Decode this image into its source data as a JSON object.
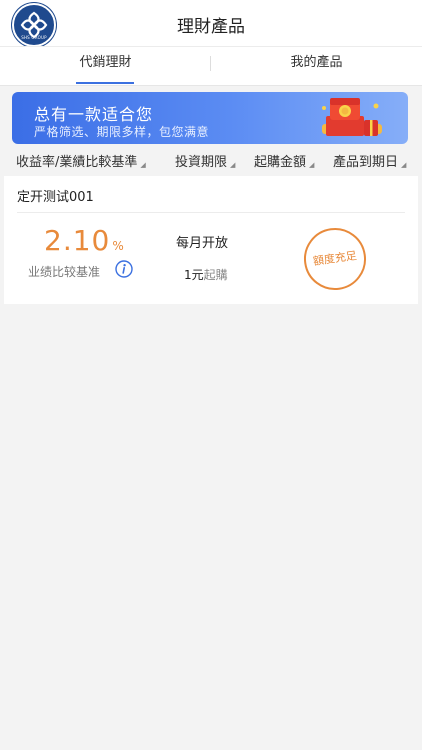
{
  "header": {
    "title": "理財產品",
    "logo_caption": "SHS GROUP"
  },
  "tabs": [
    {
      "label": "代銷理財",
      "active": true
    },
    {
      "label": "我的產品",
      "active": false
    }
  ],
  "banner": {
    "title": "总有一款适合您",
    "subtitle": "严格筛选、期限多样，包您满意"
  },
  "sort_bar": [
    {
      "label": "收益率/業績比較基準"
    },
    {
      "label": "投資期限"
    },
    {
      "label": "起購金額"
    },
    {
      "label": "產品到期日"
    }
  ],
  "products": [
    {
      "name": "定开测试001",
      "rate_value": "2.10",
      "rate_unit": "%",
      "rate_label": "业绩比较基准",
      "period": "每月开放",
      "min_amount": "1元",
      "min_suffix": "起購",
      "status": "額度充足"
    }
  ],
  "colors": {
    "accent": "#3b70e0",
    "rate": "#e88a3b",
    "logo": "#1f4a8e"
  }
}
